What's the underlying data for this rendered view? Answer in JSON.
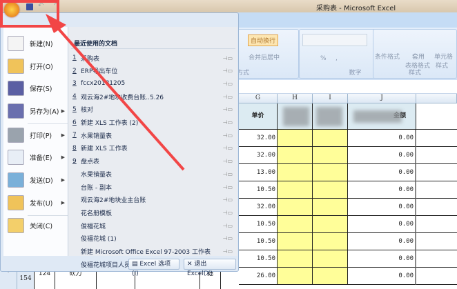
{
  "window": {
    "title": "采购表 - Microsoft Excel"
  },
  "ribbon": {
    "wrap_text": "自动换行",
    "merge_center": "合并后居中",
    "alignment_group": "方式",
    "number_group": "数字",
    "percent": "%",
    "comma": ",",
    "styles_group": "样式",
    "conditional_format": "条件格式",
    "table_format": [
      "套用",
      "表格格式"
    ],
    "cell_styles": [
      "单元格",
      "样式"
    ]
  },
  "sheet": {
    "columns": [
      "G",
      "H",
      "I",
      "J"
    ],
    "header_price": "单价",
    "header_amount": "金额",
    "prices": [
      "32.00",
      "32.00",
      "13.00",
      "10.50",
      "32.00",
      "10.50",
      "10.50",
      "10.50",
      "26.00"
    ],
    "amounts": [
      "0.00",
      "0.00",
      "0.00",
      "0.00",
      "0.00",
      "0.00",
      "0.00",
      "0.00",
      "0.00"
    ],
    "last_row": {
      "row_number": "154",
      "marker": "·",
      "id": "124",
      "name": "砍刀",
      "unit": "把"
    }
  },
  "office_menu": {
    "items": [
      {
        "label": "新建(N)",
        "icon": "new-doc-icon"
      },
      {
        "label": "打开(O)",
        "icon": "folder-open-icon"
      },
      {
        "label": "保存(S)",
        "icon": "save-icon"
      },
      {
        "label": "另存为(A)",
        "icon": "save-as-icon",
        "submenu": true
      },
      {
        "label": "打印(P)",
        "icon": "printer-icon",
        "submenu": true
      },
      {
        "label": "准备(E)",
        "icon": "prepare-icon",
        "submenu": true
      },
      {
        "label": "发送(D)",
        "icon": "send-icon",
        "submenu": true
      },
      {
        "label": "发布(U)",
        "icon": "publish-icon",
        "submenu": true
      },
      {
        "label": "关闭(C)",
        "icon": "close-folder-icon"
      }
    ],
    "recent_title": "最近使用的文档",
    "recent": [
      {
        "num": "1",
        "name": "采购表"
      },
      {
        "num": "2",
        "name": "ERP导出车位"
      },
      {
        "num": "3",
        "name": "fccx20181205"
      },
      {
        "num": "4",
        "name": "观云海2#地块收费台账..5.26"
      },
      {
        "num": "5",
        "name": "核对"
      },
      {
        "num": "6",
        "name": "新建 XLS 工作表 (2)"
      },
      {
        "num": "7",
        "name": "水果销量表"
      },
      {
        "num": "8",
        "name": "新建 XLS 工作表"
      },
      {
        "num": "9",
        "name": "盘点表"
      },
      {
        "num": "",
        "name": "水果销量表"
      },
      {
        "num": "",
        "name": "台账 - 副本"
      },
      {
        "num": "",
        "name": "观云海2#地块业主台账"
      },
      {
        "num": "",
        "name": "花名册模板"
      },
      {
        "num": "",
        "name": "俊福花城"
      },
      {
        "num": "",
        "name": "俊福花城 (1)"
      },
      {
        "num": "",
        "name": "新建 Microsoft Office Excel 97-2003 工作表"
      },
      {
        "num": "",
        "name": "俊福花城项目人员入离职情况"
      }
    ],
    "options_button": "Excel 选项(I)",
    "exit_button": "退出 Excel(X)"
  },
  "colors": {
    "annotation": "#f24646",
    "highlight": "#fffe99",
    "header_fill": "#dcebf2"
  }
}
